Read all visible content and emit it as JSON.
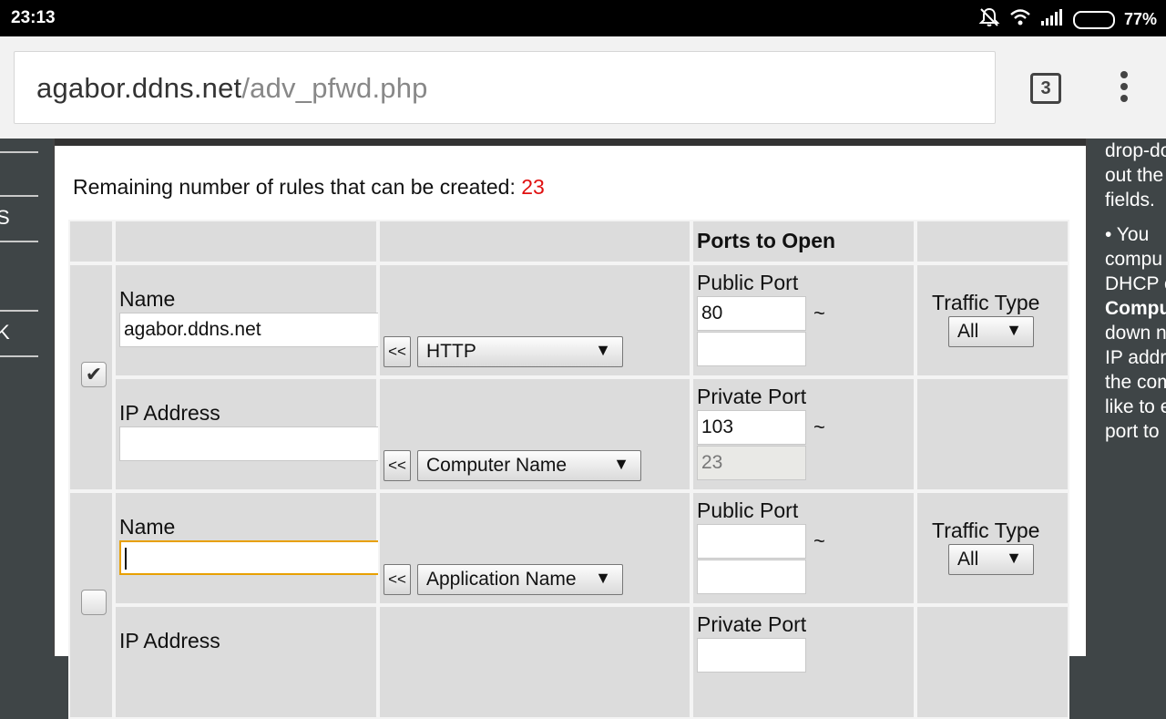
{
  "status": {
    "time": "23:13",
    "battery": "77%",
    "battery_fraction": 0.77
  },
  "browser": {
    "host": "agabor.ddns.net",
    "path": "/adv_pfwd.php",
    "tab_count": "3"
  },
  "sidebar": {
    "item_1": "S",
    "item_2": "K"
  },
  "remaining": {
    "label": "Remaining number of rules that can be created: ",
    "value": "23"
  },
  "table": {
    "header_ports": "Ports to Open",
    "rules": [
      {
        "checked": true,
        "name_label": "Name",
        "name_value": "agabor.ddns.net",
        "app_button": "<<",
        "app_select": "HTTP",
        "public_port_label": "Public Port",
        "public_port_start": "80",
        "public_port_end": "",
        "traffic_label": "Traffic Type",
        "traffic_value": "All",
        "ip_label": "IP Address",
        "ip_value": "",
        "comp_button": "<<",
        "comp_select": "Computer Name",
        "private_port_label": "Private Port",
        "private_port_start": "103",
        "private_port_end": "23"
      },
      {
        "checked": false,
        "name_label": "Name",
        "name_value": "",
        "app_button": "<<",
        "app_select": "Application Name",
        "public_port_label": "Public Port",
        "public_port_start": "",
        "public_port_end": "",
        "traffic_label": "Traffic Type",
        "traffic_value": "All",
        "ip_label": "IP Address",
        "private_port_label": "Private Port"
      }
    ],
    "tilde": "~",
    "dropdown_arrow": "▼"
  },
  "help_panel": {
    "lines": [
      "drop-do",
      "out the",
      "fields.",
      "•  You",
      "compu",
      "DHCP c",
      "Compu",
      "down n",
      "IP addr",
      "the com",
      "like to e",
      "port to"
    ]
  }
}
